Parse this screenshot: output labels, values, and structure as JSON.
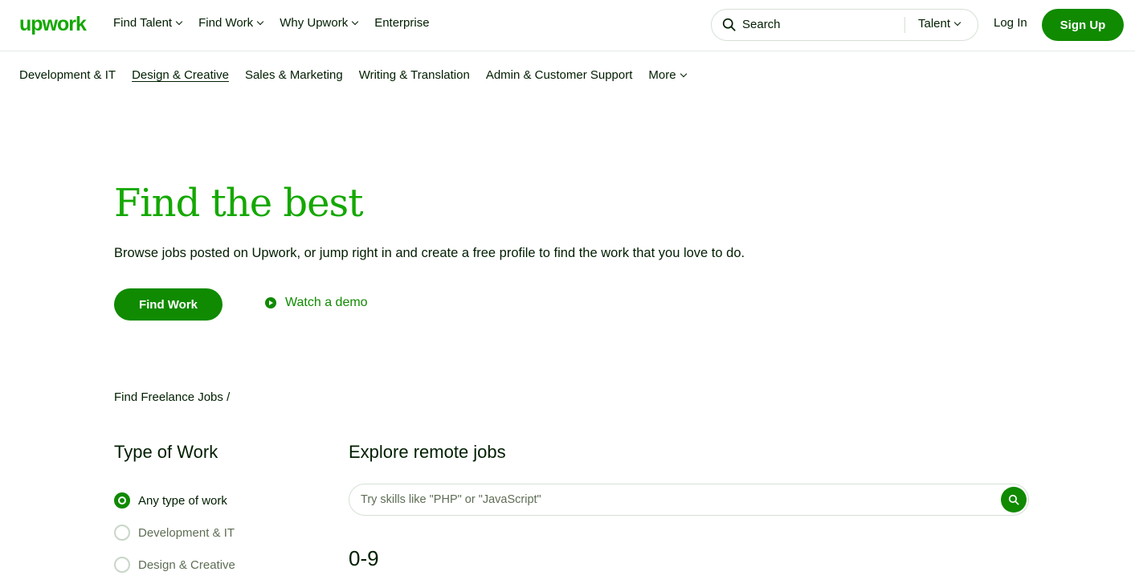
{
  "header": {
    "logo": "upwork",
    "nav": [
      {
        "label": "Find Talent",
        "has_dropdown": true
      },
      {
        "label": "Find Work",
        "has_dropdown": true
      },
      {
        "label": "Why Upwork",
        "has_dropdown": true
      },
      {
        "label": "Enterprise",
        "has_dropdown": false
      }
    ],
    "search": {
      "placeholder": "Search",
      "scope": "Talent"
    },
    "login": "Log In",
    "signup": "Sign Up"
  },
  "categories": {
    "items": [
      {
        "label": "Development & IT"
      },
      {
        "label": "Design & Creative",
        "active": true
      },
      {
        "label": "Sales & Marketing"
      },
      {
        "label": "Writing & Translation"
      },
      {
        "label": "Admin & Customer Support"
      },
      {
        "label": "More",
        "has_dropdown": true
      }
    ]
  },
  "hero": {
    "title": "Find the best",
    "subtitle": "Browse jobs posted on Upwork, or jump right in and create a free profile to find the work that you love to do.",
    "primary_button": "Find Work",
    "demo_link": "Watch a demo"
  },
  "breadcrumb": "Find Freelance Jobs /",
  "filters": {
    "title": "Type of Work",
    "options": [
      {
        "label": "Any type of work",
        "checked": true
      },
      {
        "label": "Development & IT",
        "checked": false
      },
      {
        "label": "Design & Creative",
        "checked": false
      }
    ]
  },
  "explore": {
    "title": "Explore remote jobs",
    "placeholder": "Try skills like \"PHP\" or \"JavaScript\"",
    "index_heading": "0-9"
  },
  "colors": {
    "brand_green": "#14a800",
    "button_green": "#108a00",
    "text": "#001e00"
  }
}
